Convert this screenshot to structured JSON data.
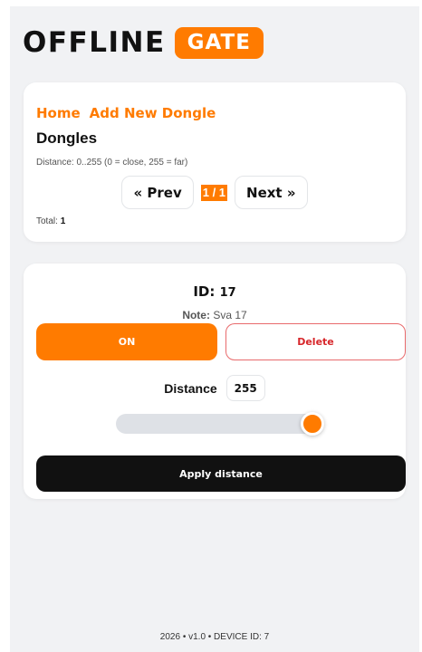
{
  "brand": {
    "word": "OFFLINE",
    "pill": "GATE",
    "accent": "#ff7b00"
  },
  "list_card": {
    "nav": {
      "home": "Home",
      "add": "Add New Dongle"
    },
    "title": "Dongles",
    "hint": "Distance: 0..255 (0 = close, 255 = far)",
    "pager": {
      "prev": "« Prev",
      "current": "1 / 1",
      "next": "Next »"
    },
    "total_label": "Total:",
    "total_value": "1"
  },
  "dongle": {
    "id_label": "ID:",
    "id_value": "17",
    "note_label": "Note:",
    "note_value": "Sva 17",
    "on_label": "ON",
    "delete_label": "Delete",
    "distance_label": "Distance",
    "distance_value": "255",
    "slider": {
      "min": 0,
      "max": 255,
      "value": 255
    },
    "apply_label": "Apply distance"
  },
  "footer": "2026 • v1.0 • DEVICE ID: 7",
  "colors": {
    "accent": "#ff7b00",
    "danger": "#d7262a",
    "dark": "#111111"
  }
}
